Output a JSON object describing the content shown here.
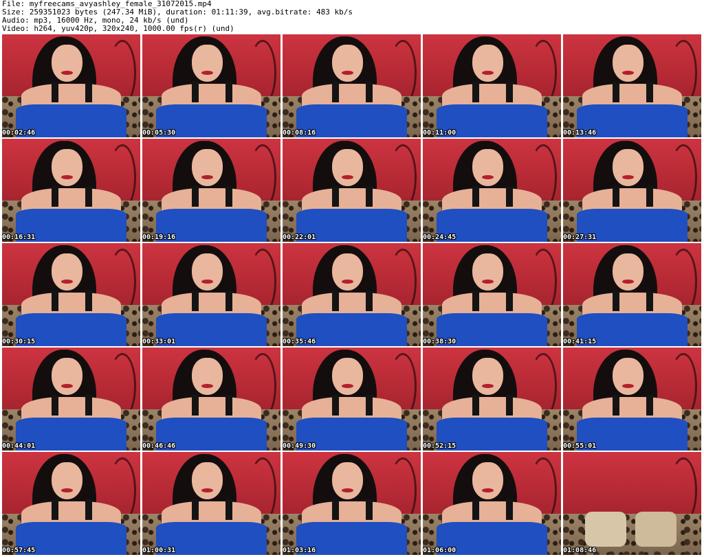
{
  "header": {
    "file": "File: myfreecams_avyashley_female_31072015.mp4",
    "size": "Size: 259351023 bytes (247.34 MiB), duration: 01:11:39, avg.bitrate: 483 kb/s",
    "audio": "Audio: mp3, 16000 Hz, mono, 24 kb/s (und)",
    "video": "Video: h264, yuv420p, 320x240, 1000.00 fps(r) (und)"
  },
  "thumbnails": [
    {
      "timestamp": "00:02:46"
    },
    {
      "timestamp": "00:05:30"
    },
    {
      "timestamp": "00:08:16"
    },
    {
      "timestamp": "00:11:00"
    },
    {
      "timestamp": "00:13:46"
    },
    {
      "timestamp": "00:16:31"
    },
    {
      "timestamp": "00:19:16"
    },
    {
      "timestamp": "00:22:01"
    },
    {
      "timestamp": "00:24:45"
    },
    {
      "timestamp": "00:27:31"
    },
    {
      "timestamp": "00:30:15"
    },
    {
      "timestamp": "00:33:01"
    },
    {
      "timestamp": "00:35:46"
    },
    {
      "timestamp": "00:38:30"
    },
    {
      "timestamp": "00:41:15"
    },
    {
      "timestamp": "00:44:01"
    },
    {
      "timestamp": "00:46:46"
    },
    {
      "timestamp": "00:49:30"
    },
    {
      "timestamp": "00:52:15"
    },
    {
      "timestamp": "00:55:01"
    },
    {
      "timestamp": "00:57:45"
    },
    {
      "timestamp": "01:00:31"
    },
    {
      "timestamp": "01:03:16"
    },
    {
      "timestamp": "01:06:00"
    },
    {
      "timestamp": "01:08:46"
    }
  ]
}
